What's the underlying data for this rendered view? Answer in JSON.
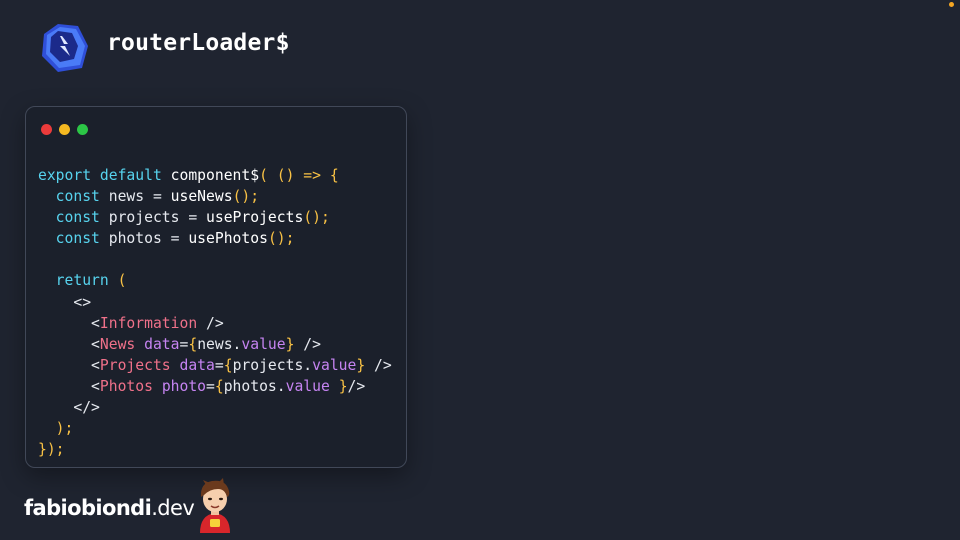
{
  "header": {
    "title": "routerLoader$",
    "logo_icon": "qwik-logo-icon"
  },
  "window": {
    "controls": [
      "close",
      "minimize",
      "maximize"
    ],
    "code_lines": [
      [
        {
          "t": "export default ",
          "c": "kw"
        },
        {
          "t": "component$",
          "c": "fn"
        },
        {
          "t": "( () => {",
          "c": "br"
        }
      ],
      [
        {
          "t": "  const ",
          "c": "kw"
        },
        {
          "t": "news = ",
          "c": "pl"
        },
        {
          "t": "useNews",
          "c": "fn"
        },
        {
          "t": "();",
          "c": "br"
        }
      ],
      [
        {
          "t": "  const ",
          "c": "kw"
        },
        {
          "t": "projects = ",
          "c": "pl"
        },
        {
          "t": "useProjects",
          "c": "fn"
        },
        {
          "t": "();",
          "c": "br"
        }
      ],
      [
        {
          "t": "  const ",
          "c": "kw"
        },
        {
          "t": "photos = ",
          "c": "pl"
        },
        {
          "t": "usePhotos",
          "c": "fn"
        },
        {
          "t": "();",
          "c": "br"
        }
      ],
      [],
      [
        {
          "t": "  return ",
          "c": "kw"
        },
        {
          "t": "(",
          "c": "br"
        }
      ],
      [
        {
          "t": "    <>",
          "c": "pl"
        }
      ],
      [
        {
          "t": "      <",
          "c": "pl"
        },
        {
          "t": "Information",
          "c": "tag"
        },
        {
          "t": " />",
          "c": "pl"
        }
      ],
      [
        {
          "t": "      <",
          "c": "pl"
        },
        {
          "t": "News ",
          "c": "tag"
        },
        {
          "t": "data",
          "c": "attr"
        },
        {
          "t": "=",
          "c": "pl"
        },
        {
          "t": "{",
          "c": "br"
        },
        {
          "t": "news.",
          "c": "pl"
        },
        {
          "t": "value",
          "c": "attr"
        },
        {
          "t": "}",
          "c": "br"
        },
        {
          "t": " />",
          "c": "pl"
        }
      ],
      [
        {
          "t": "      <",
          "c": "pl"
        },
        {
          "t": "Projects ",
          "c": "tag"
        },
        {
          "t": "data",
          "c": "attr"
        },
        {
          "t": "=",
          "c": "pl"
        },
        {
          "t": "{",
          "c": "br"
        },
        {
          "t": "projects.",
          "c": "pl"
        },
        {
          "t": "value",
          "c": "attr"
        },
        {
          "t": "}",
          "c": "br"
        },
        {
          "t": " />",
          "c": "pl"
        }
      ],
      [
        {
          "t": "      <",
          "c": "pl"
        },
        {
          "t": "Photos ",
          "c": "tag"
        },
        {
          "t": "photo",
          "c": "attr"
        },
        {
          "t": "=",
          "c": "pl"
        },
        {
          "t": "{",
          "c": "br"
        },
        {
          "t": "photos.",
          "c": "pl"
        },
        {
          "t": "value ",
          "c": "attr"
        },
        {
          "t": "}",
          "c": "br"
        },
        {
          "t": "/>",
          "c": "pl"
        }
      ],
      [
        {
          "t": "    </>",
          "c": "pl"
        }
      ],
      [
        {
          "t": "  );",
          "c": "br"
        }
      ],
      [
        {
          "t": "});",
          "c": "br"
        }
      ]
    ]
  },
  "footer": {
    "brand_bold": "fabiobiondi",
    "brand_light": ".dev",
    "mascot_icon": "mascot-avatar-icon"
  },
  "colors": {
    "background": "#1f2430",
    "window_bg": "#1b202b",
    "keyword": "#57d3ee",
    "bracket": "#f8c145",
    "tag": "#f0718a",
    "attribute": "#c684f2",
    "logo_primary": "#4a7bf7",
    "logo_secondary": "#2f4fd8"
  }
}
